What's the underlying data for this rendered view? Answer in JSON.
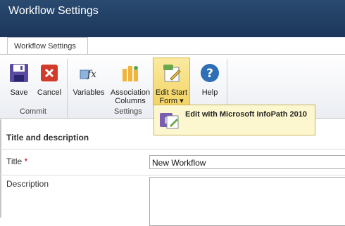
{
  "window": {
    "title": "Workflow Settings"
  },
  "tab": {
    "label": "Workflow Settings"
  },
  "ribbon": {
    "save_label": "Save",
    "cancel_label": "Cancel",
    "variables_label": "Variables",
    "association_label_1": "Association",
    "association_label_2": "Columns",
    "edit_start_label_1": "Edit Start",
    "edit_start_label_2": "Form ▾",
    "help_label": "Help",
    "group_commit": "Commit",
    "group_settings": "Settings"
  },
  "dropdown": {
    "item_label": "Edit with Microsoft InfoPath 2010"
  },
  "form": {
    "section_title": "Title and description",
    "title_label": "Title",
    "required_mark": "*",
    "title_value": "New Workflow",
    "description_label": "Description",
    "description_value": ""
  },
  "colors": {
    "titlebar": "#1b365a",
    "pressed": "#f3d464",
    "dropdown_bg": "#fdf7cf"
  }
}
